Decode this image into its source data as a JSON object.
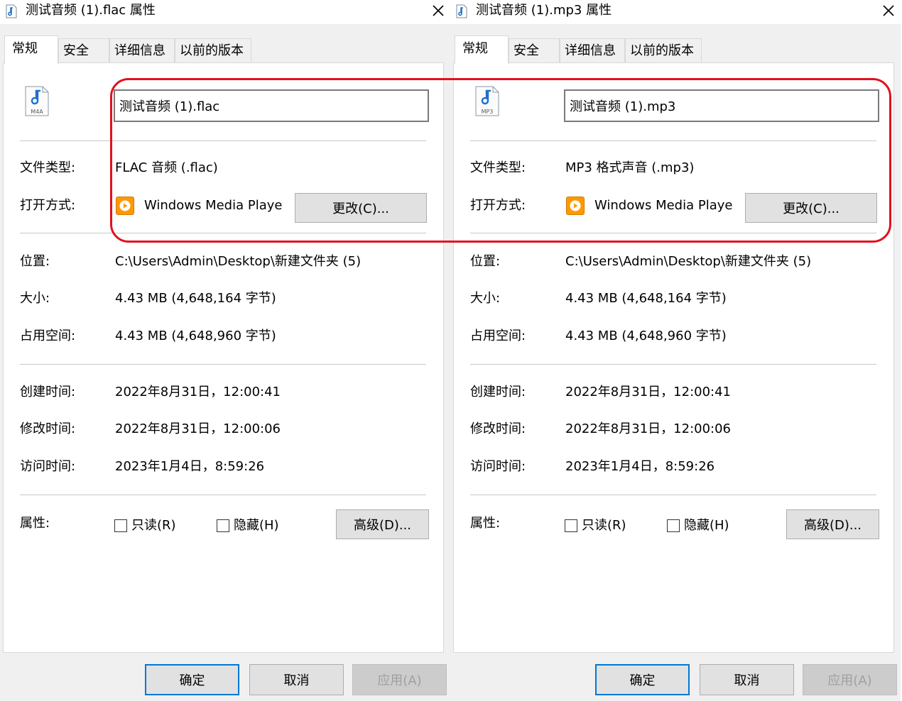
{
  "dialogs": [
    {
      "title": "测试音频 (1).flac 属性",
      "tabs": [
        "常规",
        "安全",
        "详细信息",
        "以前的版本"
      ],
      "file_name": "测试音频 (1).flac",
      "file_icon_label": "M4A",
      "file_type_label": "文件类型:",
      "file_type": "FLAC 音频 (.flac)",
      "open_with_label": "打开方式:",
      "open_with_app": "Windows Media Playe",
      "change_button": "更改(C)...",
      "location_label": "位置:",
      "location": "C:\\Users\\Admin\\Desktop\\新建文件夹 (5)",
      "size_label": "大小:",
      "size": "4.43 MB (4,648,164 字节)",
      "size_on_disk_label": "占用空间:",
      "size_on_disk": "4.43 MB (4,648,960 字节)",
      "created_label": "创建时间:",
      "created": "2022年8月31日，12:00:41",
      "modified_label": "修改时间:",
      "modified": "2022年8月31日，12:00:06",
      "accessed_label": "访问时间:",
      "accessed": "2023年1月4日，8:59:26",
      "attributes_label": "属性:",
      "readonly_label": "只读(R)",
      "hidden_label": "隐藏(H)",
      "advanced_button": "高级(D)...",
      "ok_button": "确定",
      "cancel_button": "取消",
      "apply_button": "应用(A)"
    },
    {
      "title": "测试音频 (1).mp3 属性",
      "tabs": [
        "常规",
        "安全",
        "详细信息",
        "以前的版本"
      ],
      "file_name": "测试音频 (1).mp3",
      "file_icon_label": "MP3",
      "file_type_label": "文件类型:",
      "file_type": "MP3 格式声音 (.mp3)",
      "open_with_label": "打开方式:",
      "open_with_app": "Windows Media Playe",
      "change_button": "更改(C)...",
      "location_label": "位置:",
      "location": "C:\\Users\\Admin\\Desktop\\新建文件夹 (5)",
      "size_label": "大小:",
      "size": "4.43 MB (4,648,164 字节)",
      "size_on_disk_label": "占用空间:",
      "size_on_disk": "4.43 MB (4,648,960 字节)",
      "created_label": "创建时间:",
      "created": "2022年8月31日，12:00:41",
      "modified_label": "修改时间:",
      "modified": "2022年8月31日，12:00:06",
      "accessed_label": "访问时间:",
      "accessed": "2023年1月4日，8:59:26",
      "attributes_label": "属性:",
      "readonly_label": "只读(R)",
      "hidden_label": "隐藏(H)",
      "advanced_button": "高级(D)...",
      "ok_button": "确定",
      "cancel_button": "取消",
      "apply_button": "应用(A)"
    }
  ],
  "colors": {
    "highlight": "#e3101f",
    "accent": "#0078d7",
    "wmp_icon": "#ff9900",
    "note_icon": "#1e6fd0"
  },
  "icons": {
    "title": "music-file-icon",
    "close": "close-icon",
    "file": "music-file-icon",
    "app": "windows-media-player-icon"
  }
}
